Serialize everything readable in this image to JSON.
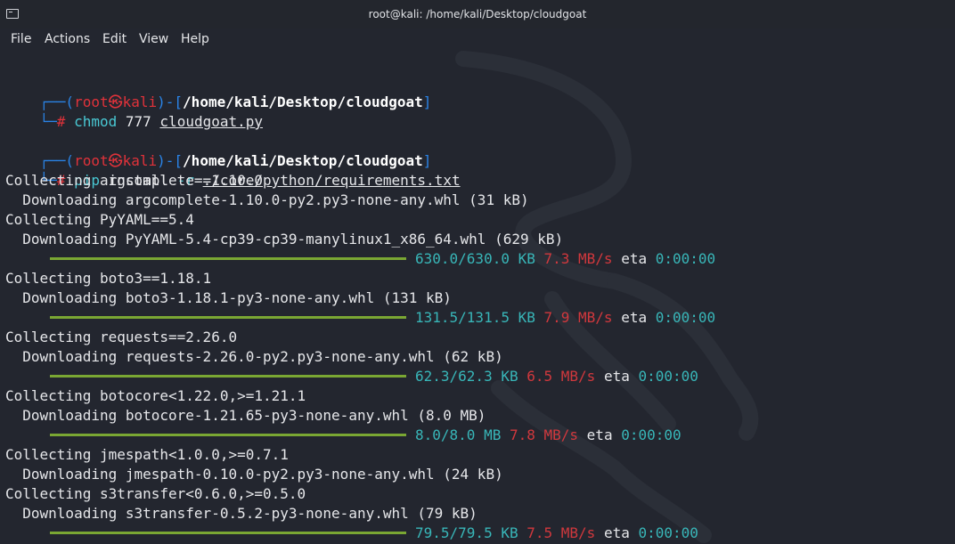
{
  "window": {
    "title": "root@kali: /home/kali/Desktop/cloudgoat"
  },
  "menu": [
    "File",
    "Actions",
    "Edit",
    "View",
    "Help"
  ],
  "prompt": {
    "user": "root",
    "host": "kali",
    "skull": "㉿",
    "path": "/home/kali/Desktop/cloudgoat",
    "open": "┌──(",
    "close": ")-[",
    "end": "]",
    "hash_prefix": "└─",
    "hash": "#"
  },
  "commands": [
    {
      "cmd": "chmod",
      "args": " 777 ",
      "target": "cloudgoat.py"
    },
    {
      "cmd": "pip",
      "args": " install ",
      "flag": "-r",
      "target": "./core/python/requirements.txt"
    }
  ],
  "output": [
    "Collecting argcomplete==1.10.0",
    "  Downloading argcomplete-1.10.0-py2.py3-none-any.whl (31 kB)",
    "Collecting PyYAML==5.4",
    "  Downloading PyYAML-5.4-cp39-cp39-manylinux1_x86_64.whl (629 kB)",
    "Collecting boto3==1.18.1",
    "  Downloading boto3-1.18.1-py3-none-any.whl (131 kB)",
    "Collecting requests==2.26.0",
    "  Downloading requests-2.26.0-py2.py3-none-any.whl (62 kB)",
    "Collecting botocore<1.22.0,>=1.21.1",
    "  Downloading botocore-1.21.65-py3-none-any.whl (8.0 MB)",
    "Collecting jmespath<1.0.0,>=0.7.1",
    "  Downloading jmespath-0.10.0-py2.py3-none-any.whl (24 kB)",
    "Collecting s3transfer<0.6.0,>=0.5.0",
    "  Downloading s3transfer-0.5.2-py3-none-any.whl (79 kB)"
  ],
  "progress": [
    {
      "size": "630.0/630.0 KB",
      "rate": "7.3 MB/s",
      "eta_label": "eta",
      "eta": "0:00:00"
    },
    {
      "size": "131.5/131.5 KB",
      "rate": "7.9 MB/s",
      "eta_label": "eta",
      "eta": "0:00:00"
    },
    {
      "size": "62.3/62.3 KB",
      "rate": "6.5 MB/s",
      "eta_label": "eta",
      "eta": "0:00:00"
    },
    {
      "size": "8.0/8.0 MB",
      "rate": "7.8 MB/s",
      "eta_label": "eta",
      "eta": "0:00:00"
    },
    {
      "size": "79.5/79.5 KB",
      "rate": "7.5 MB/s",
      "eta_label": "eta",
      "eta": "0:00:00"
    }
  ],
  "colors": {
    "background": "#23262f",
    "prompt_blue": "#2a84e7",
    "prompt_red": "#e0323a",
    "progress_bar": "#7aa733"
  }
}
